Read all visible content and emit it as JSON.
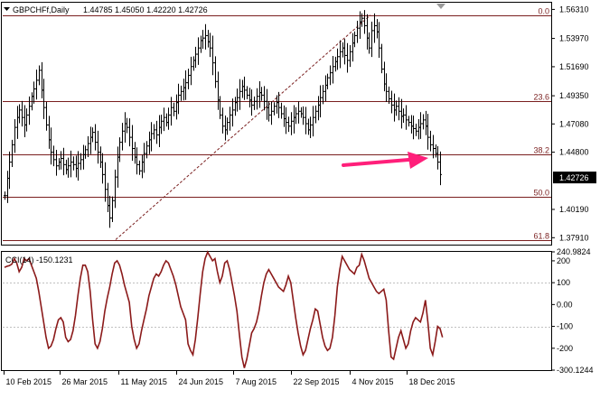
{
  "header": {
    "symbol_label": "GBPCHFf,Daily",
    "ohlc_text": "1.44785 1.45050 1.42220 1.42726"
  },
  "price_axis": {
    "ticks": [
      "1.56310",
      "1.53970",
      "1.51690",
      "1.49350",
      "1.47080",
      "1.44800",
      "1.42726",
      "1.40190",
      "1.37910"
    ],
    "current_price": "1.42726",
    "range": [
      1.3735,
      1.5685
    ]
  },
  "fibonacci": {
    "levels": [
      {
        "label": "0.0",
        "price": 1.5585
      },
      {
        "label": "23.6",
        "price": 1.4895
      },
      {
        "label": "38.2",
        "price": 1.4466
      },
      {
        "label": "50.0",
        "price": 1.412
      },
      {
        "label": "61.8",
        "price": 1.3775
      }
    ],
    "trendline": {
      "from_price": 1.3775,
      "to_price": 1.5585
    }
  },
  "cci_panel": {
    "label": "CCI(14) -150.1231",
    "ticks": [
      "240.9824",
      "200",
      "100",
      "0.00",
      "-100",
      "-200",
      "-300.1244"
    ],
    "range": [
      -300,
      241
    ],
    "reference_levels": [
      100,
      -100
    ]
  },
  "time_axis": {
    "labels": [
      "10 Feb 2015",
      "26 Mar 2015",
      "11 May 2015",
      "24 Jun 2015",
      "7 Aug 2015",
      "22 Sep 2015",
      "4 Nov 2015",
      "18 Dec 2015"
    ]
  },
  "annotation": {
    "arrow_color": "#ff1f7a"
  },
  "colors": {
    "fib_line": "#7a1f1f",
    "cci_line": "#8b1a1a",
    "bars": "#000000",
    "current_price_box": "#000000"
  },
  "chart_data": {
    "type": "line",
    "title": "GBPCHFf,Daily",
    "series": [
      {
        "name": "GBPCHFf",
        "values": [
          1.413,
          1.427,
          1.44,
          1.454,
          1.468,
          1.476,
          1.482,
          1.476,
          1.47,
          1.478,
          1.485,
          1.493,
          1.499,
          1.506,
          1.514,
          1.498,
          1.484,
          1.47,
          1.458,
          1.448,
          1.442,
          1.437,
          1.44,
          1.443,
          1.438,
          1.434,
          1.437,
          1.44,
          1.438,
          1.435,
          1.439,
          1.442,
          1.446,
          1.45,
          1.455,
          1.46,
          1.464,
          1.456,
          1.448,
          1.44,
          1.43,
          1.418,
          1.405,
          1.395,
          1.409,
          1.428,
          1.444,
          1.456,
          1.465,
          1.471,
          1.468,
          1.46,
          1.451,
          1.444,
          1.438,
          1.433,
          1.44,
          1.447,
          1.453,
          1.458,
          1.463,
          1.466,
          1.462,
          1.468,
          1.473,
          1.476,
          1.472,
          1.478,
          1.484,
          1.481,
          1.488,
          1.494,
          1.497,
          1.5,
          1.504,
          1.51,
          1.517,
          1.522,
          1.527,
          1.532,
          1.538,
          1.54,
          1.542,
          1.537,
          1.532,
          1.52,
          1.505,
          1.49,
          1.478,
          1.469,
          1.466,
          1.472,
          1.478,
          1.482,
          1.488,
          1.492,
          1.497,
          1.501,
          1.498,
          1.494,
          1.49,
          1.486,
          1.489,
          1.493,
          1.496,
          1.494,
          1.489,
          1.484,
          1.478,
          1.481,
          1.485,
          1.488,
          1.484,
          1.479,
          1.475,
          1.472,
          1.469,
          1.473,
          1.476,
          1.479,
          1.481,
          1.479,
          1.476,
          1.471,
          1.466,
          1.47,
          1.476,
          1.481,
          1.486,
          1.492,
          1.497,
          1.502,
          1.508,
          1.512,
          1.517,
          1.521,
          1.525,
          1.529,
          1.532,
          1.526,
          1.522,
          1.529,
          1.536,
          1.542,
          1.548,
          1.553,
          1.556,
          1.55,
          1.54,
          1.532,
          1.546,
          1.55,
          1.545,
          1.532,
          1.515,
          1.503,
          1.497,
          1.491,
          1.486,
          1.482,
          1.485,
          1.481,
          1.477,
          1.478,
          1.474,
          1.472,
          1.469,
          1.467,
          1.465,
          1.468,
          1.471,
          1.474,
          1.469,
          1.46,
          1.454,
          1.451,
          1.447,
          1.44,
          1.43
        ]
      },
      {
        "name": "CCI(14)",
        "values": [
          170,
          175,
          178,
          185,
          210,
          190,
          150,
          170,
          210,
          200,
          210,
          180,
          150,
          120,
          60,
          -10,
          -80,
          -150,
          -200,
          -190,
          -160,
          -110,
          -70,
          -60,
          -80,
          -150,
          -170,
          -160,
          -120,
          -50,
          40,
          120,
          180,
          180,
          150,
          60,
          -70,
          -180,
          -200,
          -170,
          -110,
          -30,
          30,
          80,
          140,
          190,
          200,
          180,
          140,
          90,
          50,
          10,
          -100,
          -160,
          -200,
          -180,
          -120,
          -70,
          -20,
          40,
          80,
          120,
          140,
          130,
          150,
          180,
          200,
          190,
          160,
          130,
          90,
          40,
          -10,
          -40,
          -70,
          -180,
          -210,
          -230,
          -160,
          -60,
          50,
          150,
          210,
          240,
          220,
          200,
          210,
          150,
          100,
          130,
          190,
          200,
          160,
          100,
          40,
          -30,
          -140,
          -240,
          -290,
          -250,
          -190,
          -130,
          -110,
          -80,
          -30,
          40,
          100,
          140,
          160,
          140,
          120,
          100,
          80,
          70,
          60,
          90,
          130,
          100,
          20,
          -60,
          -130,
          -190,
          -230,
          -210,
          -160,
          -110,
          -70,
          -20,
          -30,
          -90,
          -150,
          -190,
          -210,
          -200,
          -150,
          -50,
          80,
          160,
          220,
          200,
          180,
          160,
          150,
          140,
          170,
          180,
          230,
          200,
          160,
          120,
          100,
          80,
          60,
          50,
          60,
          70,
          20,
          -120,
          -240,
          -250,
          -200,
          -150,
          -120,
          -160,
          -200,
          -180,
          -120,
          -80,
          -60,
          -70,
          -80,
          -40,
          20,
          -80,
          -200,
          -230,
          -170,
          -100,
          -110,
          -150
        ]
      }
    ],
    "xlabel": "",
    "ylabel": ""
  }
}
